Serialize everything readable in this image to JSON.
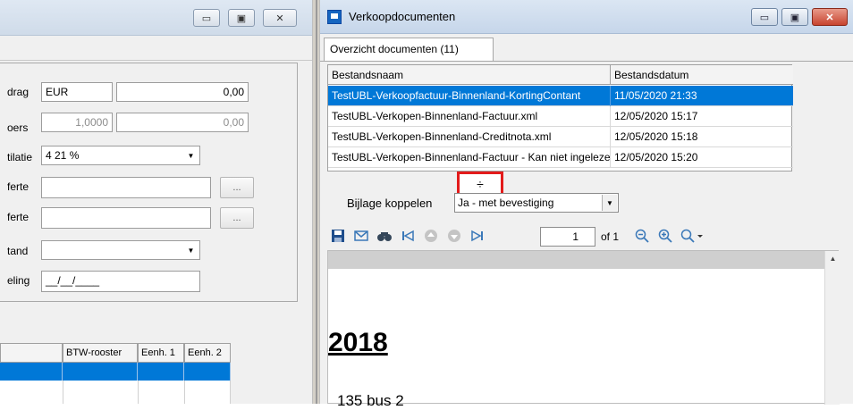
{
  "left_window": {
    "controls": {
      "minimize": "▭",
      "maximize": "▣",
      "close": "✕"
    },
    "form": {
      "amount_label": "drag",
      "amount_currency": "EUR",
      "amount_value": "0,00",
      "rate_label": "oers",
      "rate_value": "1,0000",
      "rate_amount": "0,00",
      "vat_label": "tilatie",
      "vat_value": "4   21 %",
      "offer1_label": "ferte",
      "offer2_label": "ferte",
      "status_label": "tand",
      "date_label": "eling",
      "date_value": "__/__/____",
      "browse_label": "..."
    },
    "grid": {
      "headers": [
        "",
        "BTW-rooster",
        "Eenh. 1",
        "Eenh. 2"
      ]
    }
  },
  "right_window": {
    "title": "Verkoopdocumenten",
    "controls": {
      "minimize": "▭",
      "maximize": "▣",
      "close": "✕"
    },
    "tab_label": "Overzicht documenten (11)",
    "table": {
      "columns": [
        "Bestandsnaam",
        "Bestandsdatum"
      ],
      "rows": [
        {
          "name": "TestUBL-Verkoopfactuur-Binnenland-KortingContant",
          "date": "11/05/2020 21:33",
          "selected": true
        },
        {
          "name": "TestUBL-Verkopen-Binnenland-Factuur.xml",
          "date": "12/05/2020 15:17"
        },
        {
          "name": "TestUBL-Verkopen-Binnenland-Creditnota.xml",
          "date": "12/05/2020 15:18"
        },
        {
          "name": "TestUBL-Verkopen-Binnenland-Factuur - Kan niet ingelezen",
          "date": "12/05/2020 15:20"
        }
      ]
    },
    "resize_cursor": "÷",
    "attach": {
      "label": "Bijlage koppelen",
      "value": "Ja - met bevestiging"
    },
    "viewer_toolbar": {
      "page": "1",
      "of_pages": "of 1",
      "icons": [
        "save-icon",
        "mail-icon",
        "find-icon",
        "first-page-icon",
        "previous-page-icon",
        "next-page-icon",
        "last-page-icon",
        "zoom-out-icon",
        "zoom-in-icon",
        "zoom-menu-icon"
      ]
    },
    "document": {
      "year": "2018",
      "line": "135 bus 2"
    }
  }
}
